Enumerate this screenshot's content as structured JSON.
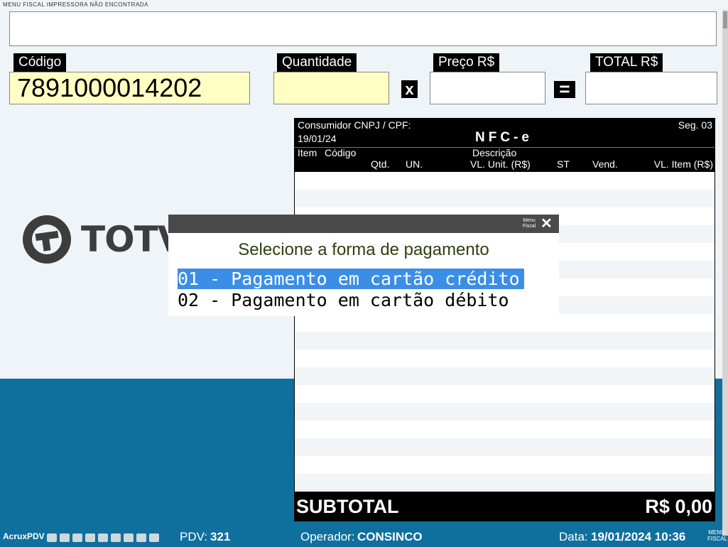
{
  "top": {
    "tiny_text": "MENU FISCAL IMPRESSORA NÃO ENCONTRADA"
  },
  "fields": {
    "codigo_label": "Código",
    "codigo_value": "7891000014202",
    "quantidade_label": "Quantidade",
    "preco_label": "Preço R$",
    "total_label": "TOTAL R$",
    "times_symbol": "x",
    "equals_symbol": "="
  },
  "logo": {
    "text": "TOTV"
  },
  "receipt": {
    "consumidor": "Consumidor CNPJ / CPF:",
    "seg": "Seg. 03",
    "date": "19/01/24",
    "title": "NFC-e",
    "col_item": "Item",
    "col_codigo": "Código",
    "col_descricao": "Descrição",
    "col_qtd": "Qtd.",
    "col_un": "UN.",
    "col_vlunit": "VL. Unit. (R$)",
    "col_st": "ST",
    "col_vend": "Vend.",
    "col_vlitem": "VL. Item (R$)"
  },
  "subtotal": {
    "label": "SUBTOTAL",
    "value": "R$ 0,00"
  },
  "dialog": {
    "menu_fiscal": "Menu Fiscal",
    "title": "Selecione a forma de pagamento",
    "options": [
      "01 - Pagamento em cartão crédito",
      "02 - Pagamento em cartão débito"
    ]
  },
  "status": {
    "app": "AcruxPDV",
    "pdv_label": "PDV:",
    "pdv_value": "321",
    "operador_label": "Operador:",
    "operador_value": "CONSINCO",
    "data_label": "Data:",
    "data_value": "19/01/2024 10:36",
    "menu_fiscal": "MENU FISCAL"
  },
  "colors": {
    "teal": "#0f6f9d",
    "selection": "#3a8ee6",
    "yellow_field": "#ffffc4"
  }
}
